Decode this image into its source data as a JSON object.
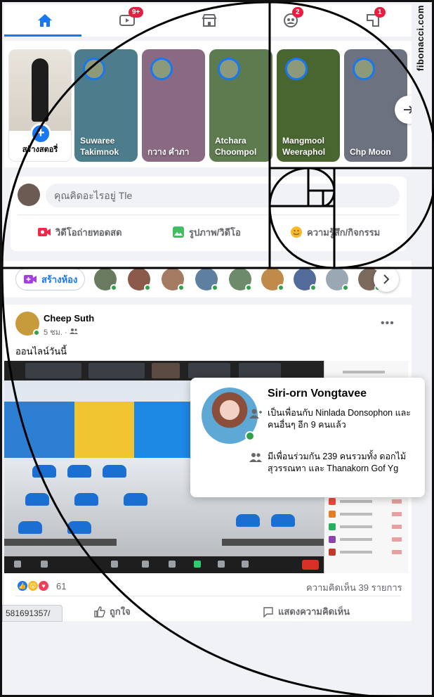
{
  "watermark": "fibonacci.com",
  "nav": {
    "items": [
      {
        "name": "home",
        "badge": ""
      },
      {
        "name": "watch",
        "badge": "9+"
      },
      {
        "name": "marketplace",
        "badge": ""
      },
      {
        "name": "groups",
        "badge": "2"
      },
      {
        "name": "gaming",
        "badge": "1"
      }
    ]
  },
  "stories": {
    "create_label": "สร้างสตอรี่",
    "items": [
      {
        "name": "Suwaree Takimnok",
        "color": "#4d7d8c"
      },
      {
        "name": "กวาง คำภา",
        "color": "#8a6a82"
      },
      {
        "name": "Atchara Choompol",
        "color": "#5e7a4f"
      },
      {
        "name": "Mangmool Weeraphol",
        "color": "#4a6630"
      },
      {
        "name": "Chp Moon",
        "color": "#6c7280"
      }
    ]
  },
  "composer": {
    "placeholder": "คุณคิดอะไรอยู่ Tle",
    "live": "วิดีโอถ่ายทอดสด",
    "photo": "รูปภาพ/วิดีโอ",
    "feeling": "ความรู้สึก/กิจกรรม"
  },
  "room": {
    "label": "สร้างห้อง"
  },
  "post": {
    "author": "Cheep Suth",
    "meta": "5 ชม. ·",
    "text": "ออนไลน์วันนี้",
    "reactions_count": "61",
    "comments_count": "ความคิดเห็น 39 รายการ",
    "like_label": "ถูกใจ",
    "comment_label": "แสดงความคิดเห็น"
  },
  "url_fragment": "581691357/",
  "hover_card": {
    "name": "Siri-orn Vongtavee",
    "friend_line": "เป็นเพื่อนกับ Ninlada Donsophon และคนอื่นๆ อีก 9 คนแล้ว",
    "mutual_line": "มีเพื่อนร่วมกัน 239 คนรวมทั้ง ดอกไม้ สุวรรณทา และ Thanakorn Gof Yg"
  },
  "colors": {
    "accent": "#1877f2",
    "online": "#31a24c",
    "badge": "#e41e3f"
  }
}
